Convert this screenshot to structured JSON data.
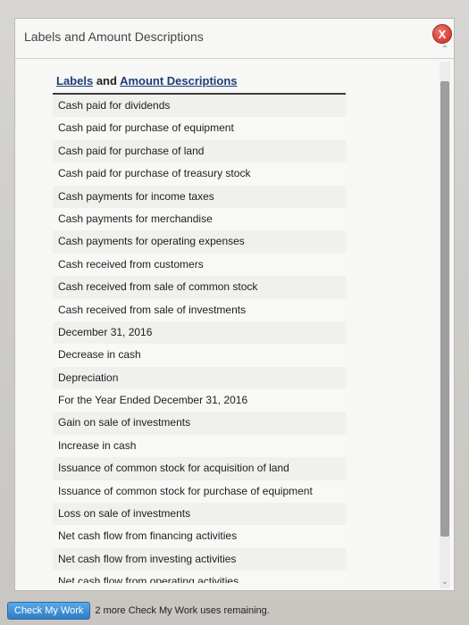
{
  "dialog": {
    "title": "Labels and Amount Descriptions",
    "close_label": "X"
  },
  "list": {
    "header_part1": "Labels",
    "header_and": "and",
    "header_part2": "Amount Descriptions",
    "items": [
      "Cash paid for dividends",
      "Cash paid for purchase of equipment",
      "Cash paid for purchase of land",
      "Cash paid for purchase of treasury stock",
      "Cash payments for income taxes",
      "Cash payments for merchandise",
      "Cash payments for operating expenses",
      "Cash received from customers",
      "Cash received from sale of common stock",
      "Cash received from sale of investments",
      "December 31, 2016",
      "Decrease in cash",
      "Depreciation",
      "For the Year Ended December 31, 2016",
      "Gain on sale of investments",
      "Increase in cash",
      "Issuance of common stock for acquisition of land",
      "Issuance of common stock for purchase of equipment",
      "Loss on sale of investments",
      "Net cash flow from financing activities",
      "Net cash flow from investing activities",
      "Net cash flow from operating activities"
    ]
  },
  "footer": {
    "check_button": "Check My Work",
    "remaining_text": "2 more Check My Work uses remaining."
  },
  "colors": {
    "close_button": "#d9463e",
    "check_button": "#2f7dc4",
    "header_link": "#1f3d7a"
  }
}
